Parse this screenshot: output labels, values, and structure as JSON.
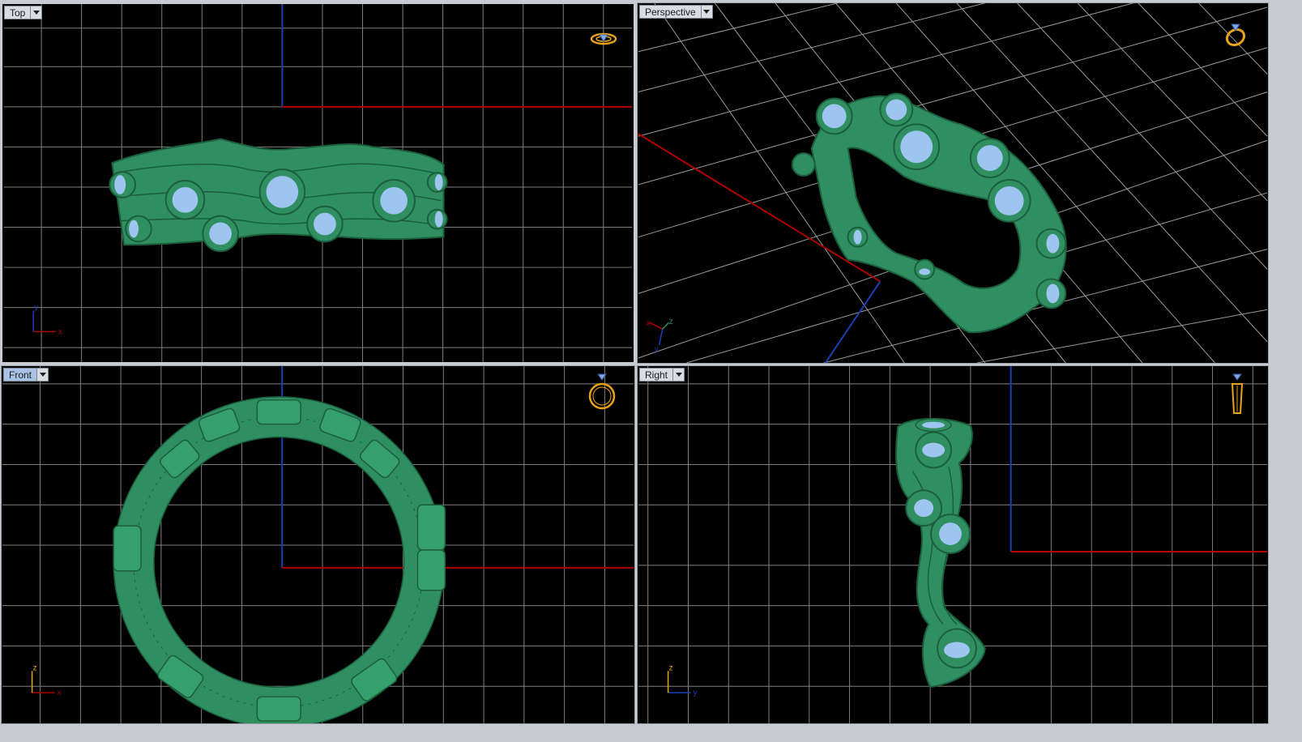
{
  "viewports": {
    "top": {
      "label": "Top",
      "axis_h": "x",
      "axis_v": "y"
    },
    "perspective": {
      "label": "Perspective",
      "axis_a": "x",
      "axis_b": "z",
      "axis_c": "y"
    },
    "front": {
      "label": "Front",
      "axis_h": "x",
      "axis_v": "z"
    },
    "right": {
      "label": "Right",
      "axis_h": "y",
      "axis_v": "z"
    }
  },
  "icons": {
    "dropdown": "chevron-down-icon",
    "view_cube": "ring-orientation-icon"
  },
  "colors": {
    "background": "#000000",
    "grid": "#8a8a8a",
    "x_axis": "#b00000",
    "y_axis": "#1a3fb8",
    "model": "#2f8f60",
    "model_wire": "#1b5e3c",
    "gem": "#9ec4f0",
    "icon": "#e8a317"
  }
}
